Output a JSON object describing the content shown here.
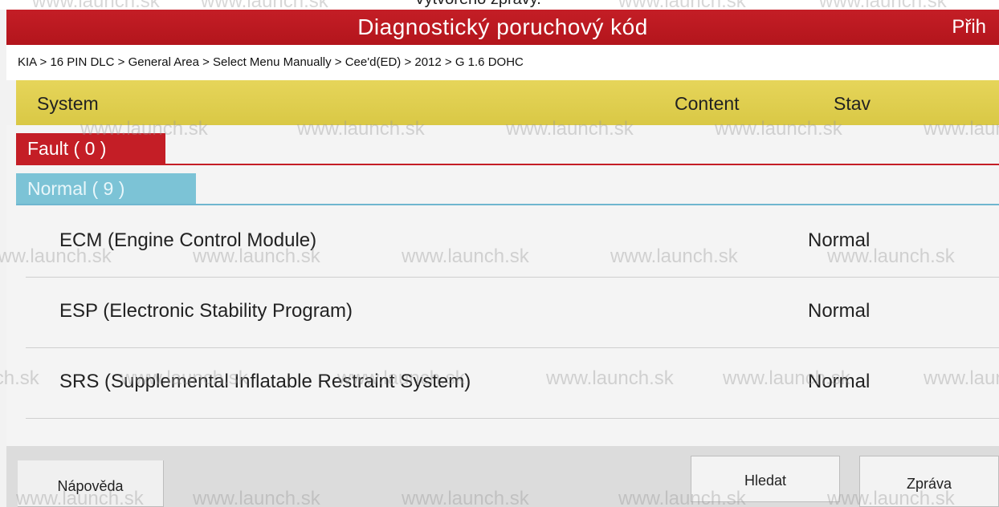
{
  "top_strip": {
    "cut_text": "Vytvořeno zprávy."
  },
  "title_bar": {
    "title": "Diagnostický poruchový kód",
    "login_label": "Přih"
  },
  "breadcrumb": "KIA > 16 PIN DLC > General Area > Select Menu Manually > Cee'd(ED) > 2012 > G 1.6 DOHC",
  "columns": {
    "system": "System",
    "content": "Content",
    "stav": "Stav"
  },
  "sections": {
    "fault": "Fault ( 0 )",
    "normal": "Normal ( 9 )"
  },
  "rows": [
    {
      "system": "ECM (Engine Control Module)",
      "stav": "Normal"
    },
    {
      "system": "ESP (Electronic Stability Program)",
      "stav": "Normal"
    },
    {
      "system": "SRS (Supplemental Inflatable Restraint System)",
      "stav": "Normal"
    }
  ],
  "buttons": {
    "help": "Nápověda",
    "search": "Hledat",
    "report": "Zpráva"
  },
  "watermark": "www.launch.sk",
  "colors": {
    "title_red": "#c41e26",
    "header_yellow": "#e6d55a",
    "normal_blue": "#7cc3d6"
  }
}
